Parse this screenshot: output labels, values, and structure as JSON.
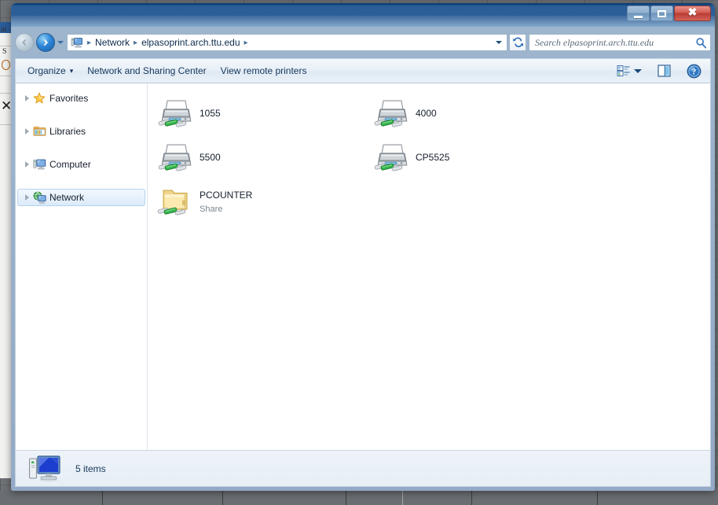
{
  "window": {
    "title": "",
    "controls": {
      "minimize": "Minimize",
      "maximize": "Maximize",
      "close": "Close"
    }
  },
  "navigation": {
    "back_label": "Back",
    "forward_label": "Forward",
    "recent_pages_label": "Recent pages",
    "refresh_label": "Refresh",
    "breadcrumb": [
      {
        "label": "Network"
      },
      {
        "label": "elpasoprint.arch.ttu.edu"
      }
    ],
    "breadcrumb_separator": "▸",
    "previous_locations_label": "Previous locations"
  },
  "search": {
    "placeholder": "Search elpasoprint.arch.ttu.edu",
    "value": "",
    "icon": "search-icon"
  },
  "command_bar": {
    "organize": "Organize",
    "organize_caret": "▾",
    "network_sharing_center": "Network and Sharing Center",
    "view_remote_printers": "View remote printers",
    "change_view_label": "Change your view",
    "change_view_caret": "▾",
    "preview_pane_label": "Show the preview pane",
    "help_label": "Get help",
    "help_glyph": "?"
  },
  "sidebar": {
    "items": [
      {
        "label": "Favorites",
        "icon": "star-icon",
        "selected": false
      },
      {
        "label": "Libraries",
        "icon": "library-folder-icon",
        "selected": false
      },
      {
        "label": "Computer",
        "icon": "computer-icon",
        "selected": false
      },
      {
        "label": "Network",
        "icon": "network-icon",
        "selected": true
      }
    ]
  },
  "content": {
    "items": [
      {
        "name": "1055",
        "subtitle": "",
        "icon": "network-printer-icon"
      },
      {
        "name": "4000",
        "subtitle": "",
        "icon": "network-printer-icon"
      },
      {
        "name": "5500",
        "subtitle": "",
        "icon": "network-printer-icon"
      },
      {
        "name": "CP5525",
        "subtitle": "",
        "icon": "network-printer-icon"
      },
      {
        "name": "PCOUNTER",
        "subtitle": "Share",
        "icon": "network-share-folder-icon"
      }
    ]
  },
  "status_bar": {
    "item_count_text": "5 items",
    "icon": "computer-icon"
  },
  "colors": {
    "titlebar_blue": "#2a5c96",
    "close_red": "#c04a40",
    "selection_blue": "#dceafa",
    "selection_border": "#b5d3f0",
    "link_text": "#16375c",
    "item_text": "#151f2d",
    "subtitle_text": "#7d8690",
    "printer_green": "#2faa4a",
    "folder_yellow": "#fbe08a"
  },
  "background": {
    "fragments": [
      "at",
      "S",
      "C"
    ]
  }
}
